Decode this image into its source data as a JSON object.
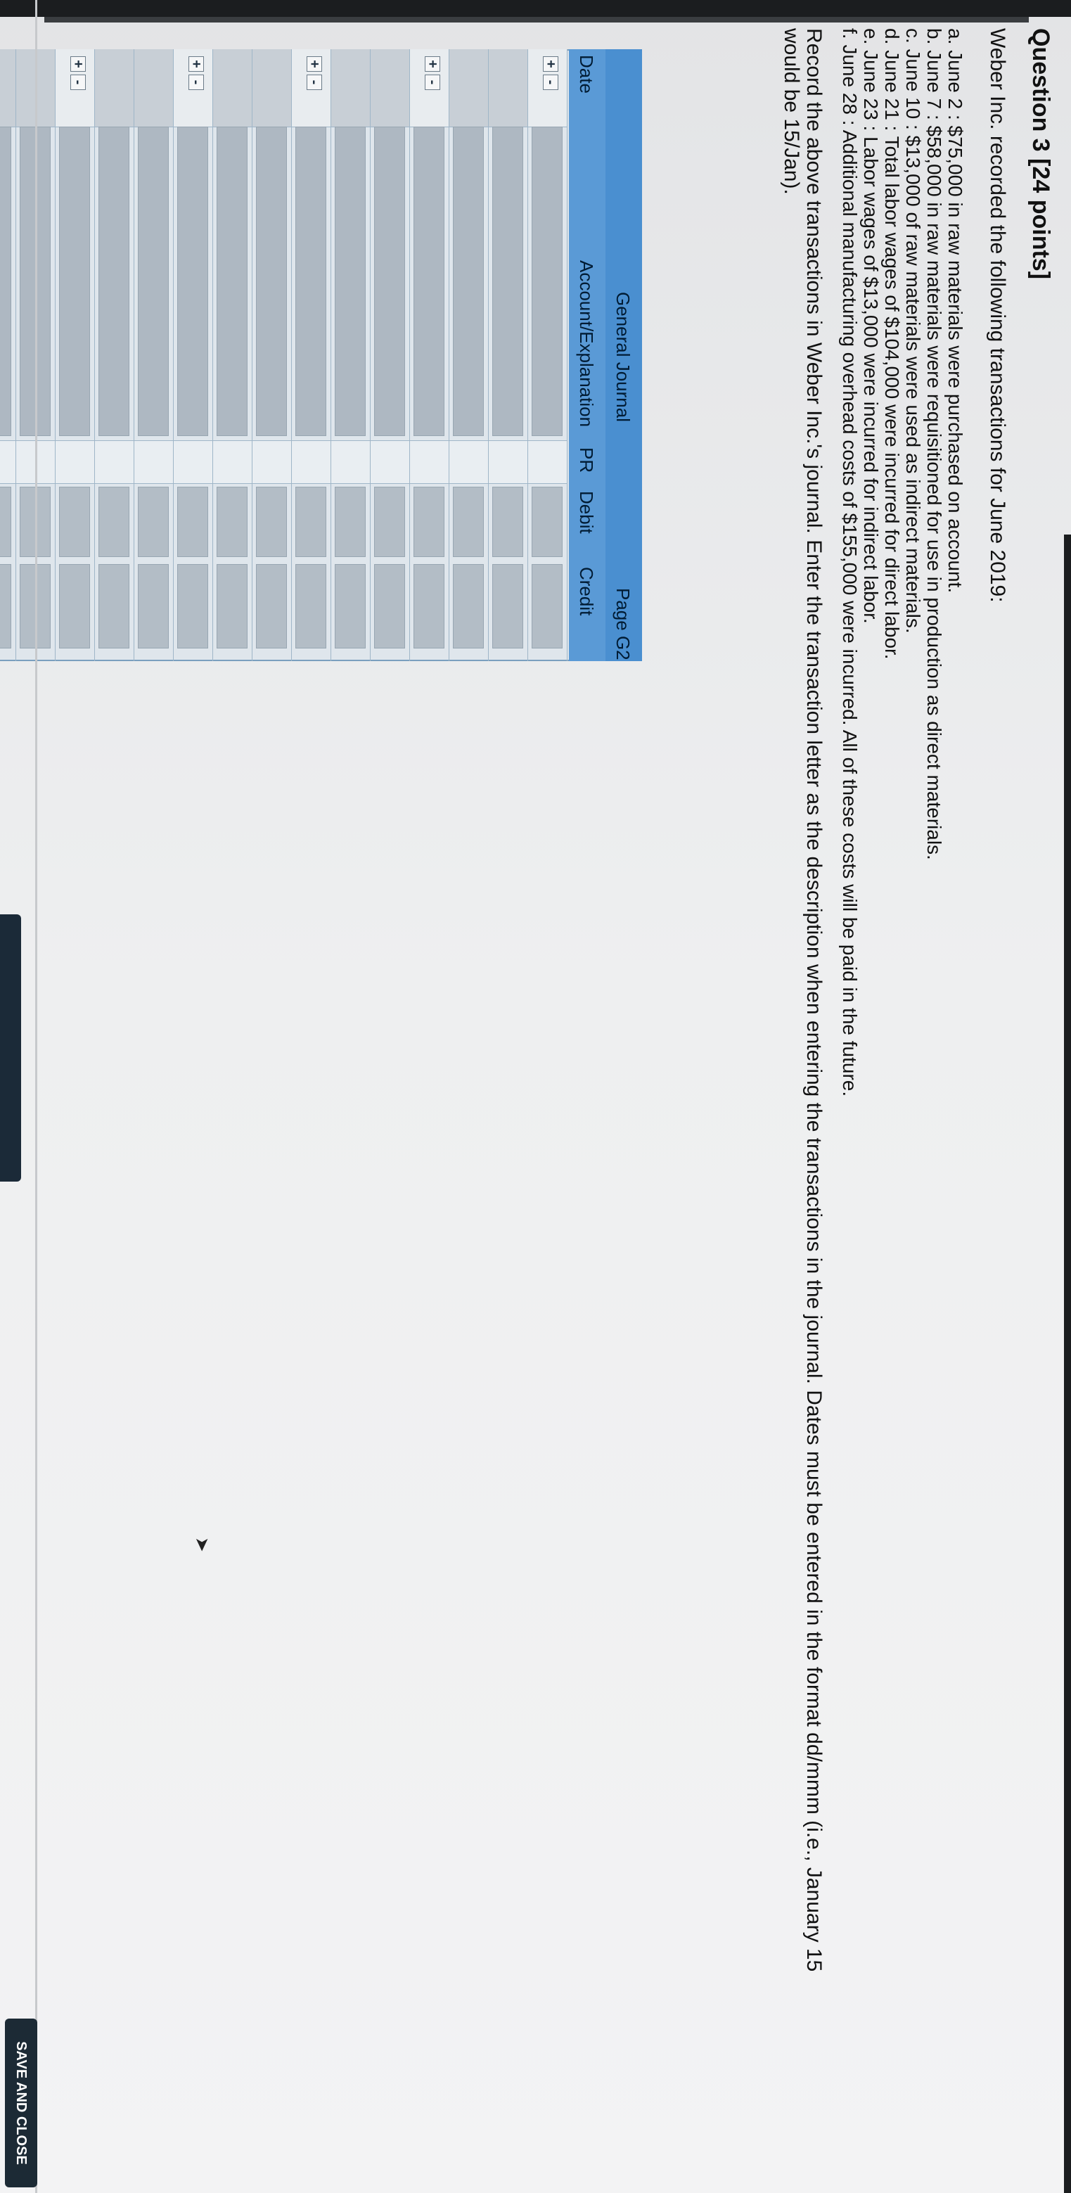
{
  "question": {
    "title": "Question 3 [24 points]",
    "intro": "Weber Inc. recorded the following transactions for June 2019:",
    "transactions": [
      "a. June 2 : $75,000 in raw materials were purchased on account.",
      "b. June 7 : $58,000 in raw materials were requisitioned for use in production as direct materials.",
      "c. June 10 : $13,000 of raw materials were used as indirect materials.",
      "d. June 21 : Total labor wages of $104,000 were incurred for direct labor.",
      "e. June 23 : Labor wages of $13,000 were incurred for indirect labor.",
      "f. June 28 : Additional manufacturing overhead costs of $155,000 were incurred. All of these costs will be paid in the future."
    ],
    "instructions": "Record the above transactions in Weber Inc.'s journal. Enter the transaction letter as the description when entering the transactions in the journal. Dates must be entered in the format dd/mmm (i.e., January 15 would be 15/Jan)."
  },
  "journal": {
    "title": "General Journal",
    "page": "Page G2",
    "columns": {
      "date": "Date",
      "account": "Account/Explanation",
      "pr": "PR",
      "debit": "Debit",
      "credit": "Credit"
    },
    "plus_label": "+",
    "minus_label": "-",
    "row_count": 19
  },
  "footer": {
    "save_label": "SAVE AND CLOSE"
  }
}
